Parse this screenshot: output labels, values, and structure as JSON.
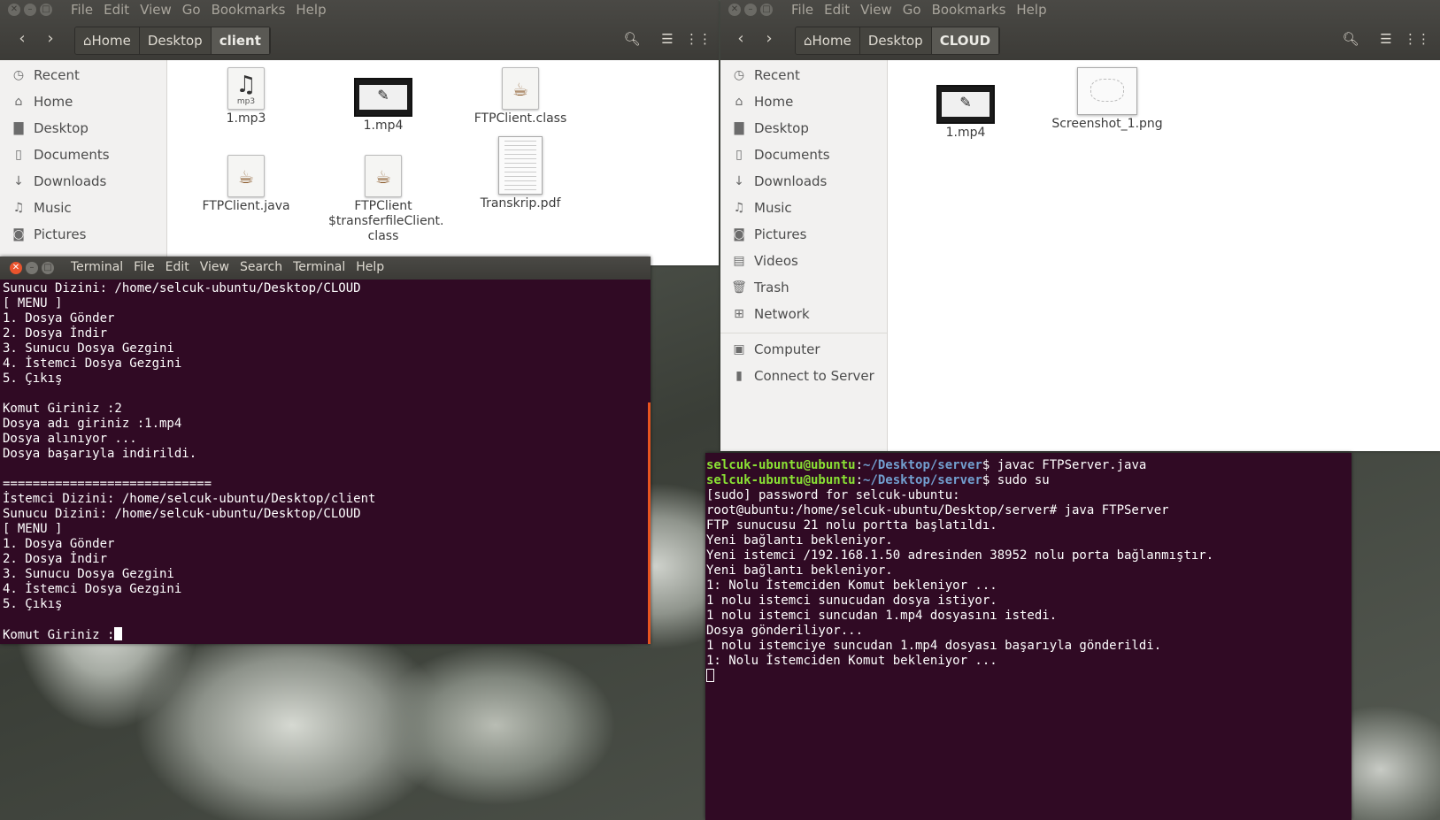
{
  "menus": {
    "files": [
      "File",
      "Edit",
      "View",
      "Go",
      "Bookmarks",
      "Help"
    ],
    "terminal": [
      "Terminal",
      "File",
      "Edit",
      "View",
      "Search",
      "Terminal",
      "Help"
    ]
  },
  "sidebar_items": [
    "Recent",
    "Home",
    "Desktop",
    "Documents",
    "Downloads",
    "Music",
    "Pictures",
    "Videos",
    "Trash",
    "Network"
  ],
  "sidebar_extra": [
    "Computer",
    "Connect to Server"
  ],
  "fm_left": {
    "breadcrumbs": [
      "Home",
      "Desktop",
      "client"
    ],
    "files": [
      {
        "name": "1.mp3",
        "kind": "audio"
      },
      {
        "name": "1.mp4",
        "kind": "video"
      },
      {
        "name": "FTPClient.class",
        "kind": "java"
      },
      {
        "name": "FTPClient.java",
        "kind": "java"
      },
      {
        "name": "FTPClient $transferfileClient. class",
        "kind": "java"
      },
      {
        "name": "Transkrip.pdf",
        "kind": "pdf"
      }
    ]
  },
  "fm_right": {
    "breadcrumbs": [
      "Home",
      "Desktop",
      "CLOUD"
    ],
    "files": [
      {
        "name": "1.mp4",
        "kind": "video"
      },
      {
        "name": "Screenshot_1.png",
        "kind": "image"
      }
    ]
  },
  "client_terminal": {
    "lines": [
      "Sunucu Dizini: /home/selcuk-ubuntu/Desktop/CLOUD",
      "[ MENU ]",
      "1. Dosya Gönder",
      "2. Dosya İndir",
      "3. Sunucu Dosya Gezgini",
      "4. İstemci Dosya Gezgini",
      "5. Çıkış",
      "",
      "Komut Giriniz :2",
      "Dosya adı giriniz :1.mp4",
      "Dosya alınıyor ...",
      "Dosya başarıyla indirildi.",
      "",
      "============================",
      "İstemci Dizini: /home/selcuk-ubuntu/Desktop/client",
      "Sunucu Dizini: /home/selcuk-ubuntu/Desktop/CLOUD",
      "[ MENU ]",
      "1. Dosya Gönder",
      "2. Dosya İndir",
      "3. Sunucu Dosya Gezgini",
      "4. İstemci Dosya Gezgini",
      "5. Çıkış",
      ""
    ],
    "prompt": "Komut Giriniz :"
  },
  "server_terminal": {
    "prompt_user": "selcuk-ubuntu@ubuntu",
    "prompt_path": "~/Desktop/server",
    "commands": [
      "$ javac FTPServer.java",
      "$ sudo su"
    ],
    "lines": [
      "[sudo] password for selcuk-ubuntu:",
      "root@ubuntu:/home/selcuk-ubuntu/Desktop/server# java FTPServer",
      "FTP sunucusu 21 nolu portta başlatıldı.",
      "Yeni bağlantı bekleniyor.",
      "Yeni istemci /192.168.1.50 adresinden 38952 nolu porta bağlanmıştır.",
      "Yeni bağlantı bekleniyor.",
      "1: Nolu İstemciden Komut bekleniyor ...",
      "1 nolu istemci sunucudan dosya istiyor.",
      "1 nolu istemci suncudan 1.mp4 dosyasını istedi.",
      "Dosya gönderiliyor...",
      "1 nolu istemciye suncudan 1.mp4 dosyası başarıyla gönderildi.",
      "1: Nolu İstemciden Komut bekleniyor ..."
    ]
  },
  "colors": {
    "terminal_bg": "#300a24",
    "prompt_user": "#8ae234",
    "prompt_path": "#729fcf",
    "accent": "#e95420"
  }
}
